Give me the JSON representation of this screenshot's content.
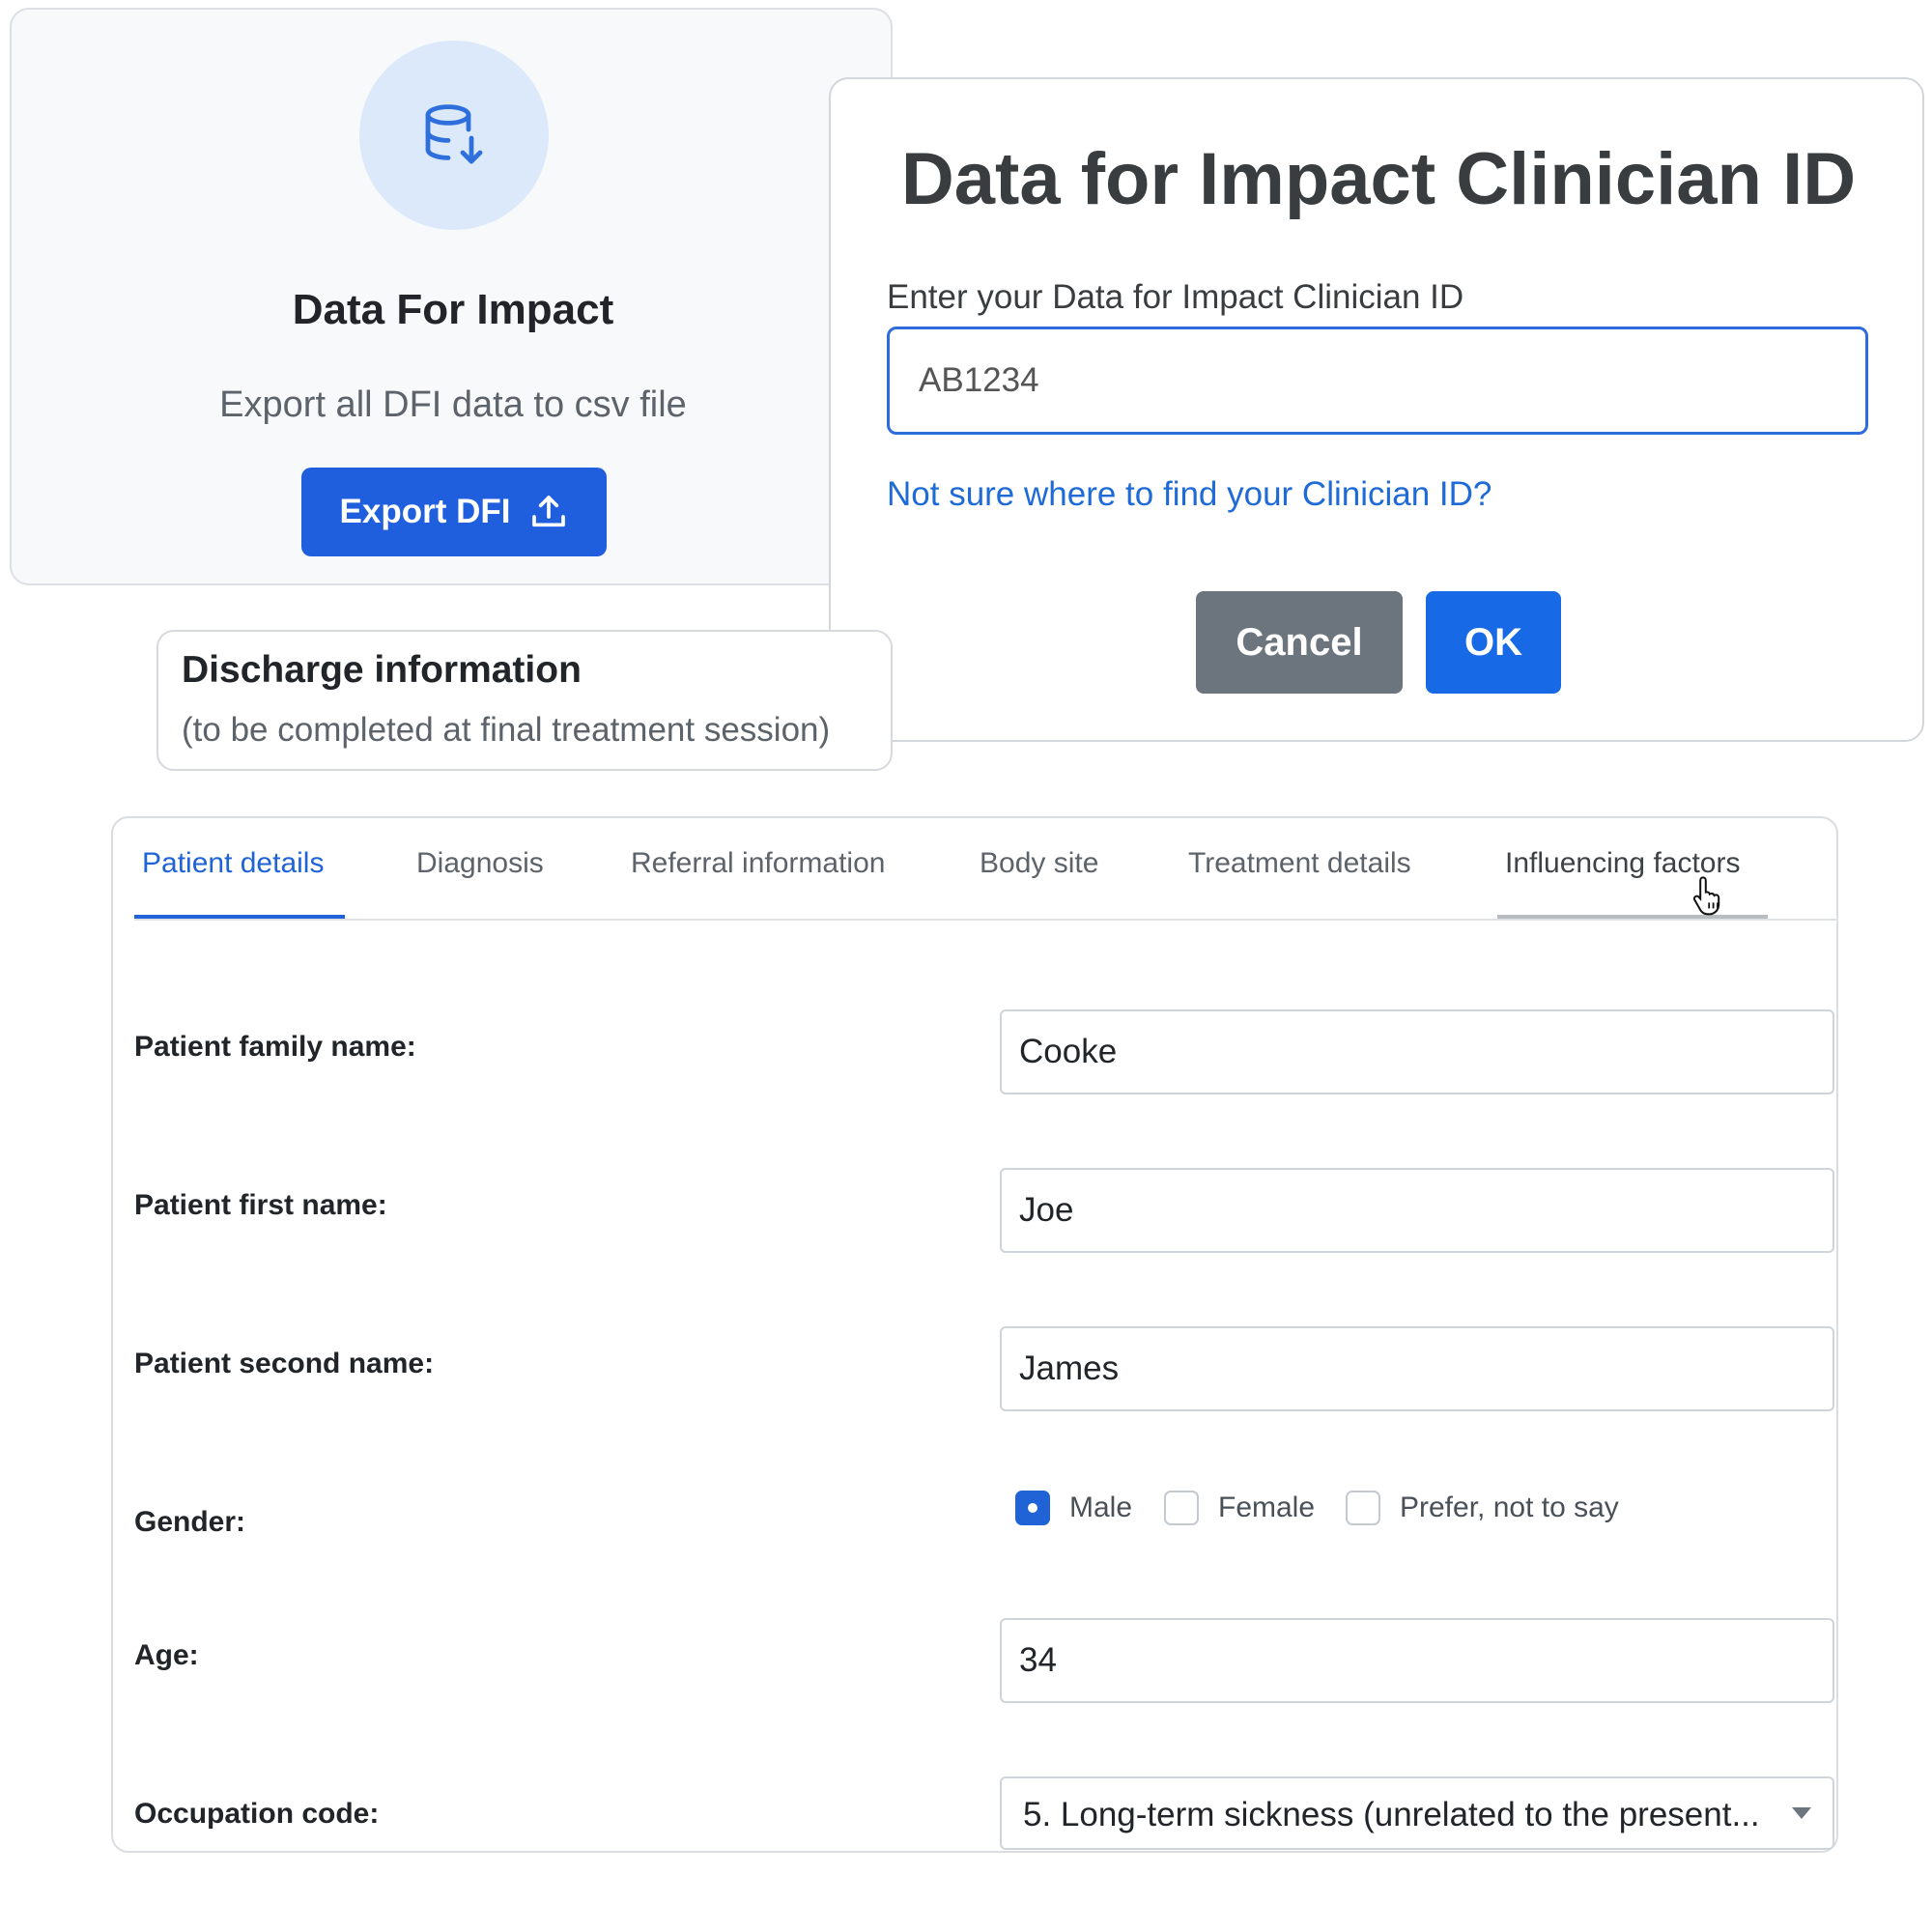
{
  "dfi_card": {
    "icon": "database-download-icon",
    "title": "Data For Impact",
    "subtitle": "Export all DFI data to csv file",
    "export_button": "Export DFI",
    "export_icon": "upload-icon"
  },
  "clinician_modal": {
    "title": "Data for Impact Clinician ID",
    "input_label": "Enter your Data for Impact Clinician ID",
    "input_value": "AB1234",
    "help_link": "Not sure where to find your Clinician ID?",
    "cancel_button": "Cancel",
    "ok_button": "OK"
  },
  "discharge": {
    "title": "Discharge information",
    "subtitle": "(to be completed at final treatment session)"
  },
  "tabs": [
    {
      "label": "Patient details",
      "active": true
    },
    {
      "label": "Diagnosis",
      "active": false
    },
    {
      "label": "Referral information",
      "active": false
    },
    {
      "label": "Body site",
      "active": false
    },
    {
      "label": "Treatment details",
      "active": false
    },
    {
      "label": "Influencing factors",
      "active": false,
      "hovered": true
    }
  ],
  "form": {
    "family_name": {
      "label": "Patient family name:",
      "value": "Cooke"
    },
    "first_name": {
      "label": "Patient first name:",
      "value": "Joe"
    },
    "second_name": {
      "label": "Patient second name:",
      "value": "James"
    },
    "gender": {
      "label": "Gender:",
      "options": [
        "Male",
        "Female",
        "Prefer, not to say"
      ],
      "selected": "Male"
    },
    "age": {
      "label": "Age:",
      "value": "34"
    },
    "occupation": {
      "label": "Occupation code:",
      "value": "5. Long-term sickness (unrelated to the present..."
    }
  },
  "colors": {
    "primary": "#1f63d6",
    "secondary_button": "#6c757d",
    "icon_circle": "#dbe9fb"
  }
}
